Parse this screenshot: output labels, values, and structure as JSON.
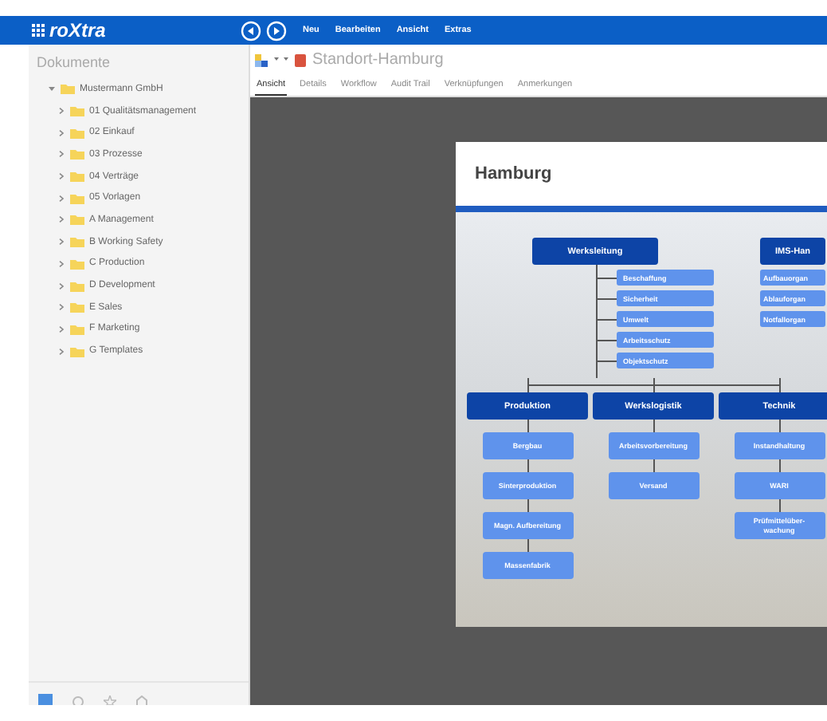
{
  "app": {
    "title": "roXtra"
  },
  "menu": [
    "Neu",
    "Bearbeiten",
    "Ansicht",
    "Extras"
  ],
  "sidebar": {
    "title": "Dokumente",
    "tree": [
      {
        "label": "Mustermann GmbH",
        "expanded": true,
        "children": [
          {
            "label": "01 Qualitätsmanagement",
            "expanded": false
          },
          {
            "label": "02 Einkauf",
            "expanded": false
          },
          {
            "label": "03 Prozesse",
            "expanded": false
          },
          {
            "label": "04 Verträge",
            "expanded": false
          },
          {
            "label": "05 Vorlagen",
            "expanded": false
          },
          {
            "label": "A Management",
            "expanded": false
          },
          {
            "label": "B Working Safety",
            "expanded": false
          },
          {
            "label": "C Production",
            "expanded": false
          },
          {
            "label": "D Development",
            "expanded": false
          },
          {
            "label": "E Sales",
            "expanded": false
          },
          {
            "label": "F Marketing",
            "expanded": false
          },
          {
            "label": "G Templates",
            "expanded": false
          }
        ]
      }
    ]
  },
  "breadcrumb": {
    "title": "Standort-Hamburg"
  },
  "tabs": [
    {
      "label": "Ansicht",
      "selected": true
    },
    {
      "label": "Details",
      "selected": false
    },
    {
      "label": "Workflow",
      "selected": false
    },
    {
      "label": "Audit Trail",
      "selected": false
    },
    {
      "label": "Verknüpfungen",
      "selected": false
    },
    {
      "label": "Anmerkungen",
      "selected": false
    }
  ],
  "document": {
    "title": "Hamburg",
    "org_chart": {
      "top_units": [
        {
          "name": "Werksleitung",
          "staff": [
            "Beschaffung",
            "Sicherheit",
            "Umwelt",
            "Arbeitsschutz",
            "Objektschutz"
          ]
        },
        {
          "name": "IMS-Han",
          "staff": [
            "Aufbauorgan",
            "Ablauforgan",
            "Notfallorgan"
          ]
        }
      ],
      "departments": [
        {
          "name": "Produktion",
          "units": [
            "Bergbau",
            "Sinterproduktion",
            "Magn. Aufbereitung",
            "Massenfabrik"
          ]
        },
        {
          "name": "Werkslogistik",
          "units": [
            "Arbeitsvorbereitung",
            "Versand"
          ]
        },
        {
          "name": "Technik",
          "units": [
            "Instandhaltung",
            "WARI",
            "Prüfmittelüber-\nwachung"
          ]
        }
      ]
    }
  }
}
